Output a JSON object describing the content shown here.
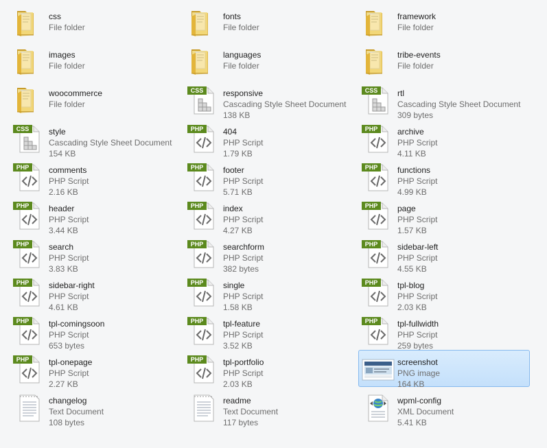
{
  "files": [
    {
      "name": "css",
      "type": "File folder",
      "size": "",
      "icon": "folder-icon"
    },
    {
      "name": "fonts",
      "type": "File folder",
      "size": "",
      "icon": "folder-icon"
    },
    {
      "name": "framework",
      "type": "File folder",
      "size": "",
      "icon": "folder-icon"
    },
    {
      "name": "images",
      "type": "File folder",
      "size": "",
      "icon": "folder-icon"
    },
    {
      "name": "languages",
      "type": "File folder",
      "size": "",
      "icon": "folder-icon"
    },
    {
      "name": "tribe-events",
      "type": "File folder",
      "size": "",
      "icon": "folder-icon"
    },
    {
      "name": "woocommerce",
      "type": "File folder",
      "size": "",
      "icon": "folder-icon"
    },
    {
      "name": "responsive",
      "type": "Cascading Style Sheet Document",
      "size": "138 KB",
      "icon": "css-file-icon"
    },
    {
      "name": "rtl",
      "type": "Cascading Style Sheet Document",
      "size": "309 bytes",
      "icon": "css-file-icon"
    },
    {
      "name": "style",
      "type": "Cascading Style Sheet Document",
      "size": "154 KB",
      "icon": "css-file-icon"
    },
    {
      "name": "404",
      "type": "PHP Script",
      "size": "1.79 KB",
      "icon": "php-file-icon"
    },
    {
      "name": "archive",
      "type": "PHP Script",
      "size": "4.11 KB",
      "icon": "php-file-icon"
    },
    {
      "name": "comments",
      "type": "PHP Script",
      "size": "2.16 KB",
      "icon": "php-file-icon"
    },
    {
      "name": "footer",
      "type": "PHP Script",
      "size": "5.71 KB",
      "icon": "php-file-icon"
    },
    {
      "name": "functions",
      "type": "PHP Script",
      "size": "4.99 KB",
      "icon": "php-file-icon"
    },
    {
      "name": "header",
      "type": "PHP Script",
      "size": "3.44 KB",
      "icon": "php-file-icon"
    },
    {
      "name": "index",
      "type": "PHP Script",
      "size": "4.27 KB",
      "icon": "php-file-icon"
    },
    {
      "name": "page",
      "type": "PHP Script",
      "size": "1.57 KB",
      "icon": "php-file-icon"
    },
    {
      "name": "search",
      "type": "PHP Script",
      "size": "3.83 KB",
      "icon": "php-file-icon"
    },
    {
      "name": "searchform",
      "type": "PHP Script",
      "size": "382 bytes",
      "icon": "php-file-icon"
    },
    {
      "name": "sidebar-left",
      "type": "PHP Script",
      "size": "4.55 KB",
      "icon": "php-file-icon"
    },
    {
      "name": "sidebar-right",
      "type": "PHP Script",
      "size": "4.61 KB",
      "icon": "php-file-icon"
    },
    {
      "name": "single",
      "type": "PHP Script",
      "size": "1.58 KB",
      "icon": "php-file-icon"
    },
    {
      "name": "tpl-blog",
      "type": "PHP Script",
      "size": "2.03 KB",
      "icon": "php-file-icon"
    },
    {
      "name": "tpl-comingsoon",
      "type": "PHP Script",
      "size": "653 bytes",
      "icon": "php-file-icon"
    },
    {
      "name": "tpl-feature",
      "type": "PHP Script",
      "size": "3.52 KB",
      "icon": "php-file-icon"
    },
    {
      "name": "tpl-fullwidth",
      "type": "PHP Script",
      "size": "259 bytes",
      "icon": "php-file-icon"
    },
    {
      "name": "tpl-onepage",
      "type": "PHP Script",
      "size": "2.27 KB",
      "icon": "php-file-icon"
    },
    {
      "name": "tpl-portfolio",
      "type": "PHP Script",
      "size": "2.03 KB",
      "icon": "php-file-icon"
    },
    {
      "name": "screenshot",
      "type": "PNG image",
      "size": "164 KB",
      "icon": "png-image-icon",
      "selected": true
    },
    {
      "name": "changelog",
      "type": "Text Document",
      "size": "108 bytes",
      "icon": "text-file-icon"
    },
    {
      "name": "readme",
      "type": "Text Document",
      "size": "117 bytes",
      "icon": "text-file-icon"
    },
    {
      "name": "wpml-config",
      "type": "XML Document",
      "size": "5.41 KB",
      "icon": "xml-file-icon"
    }
  ],
  "colors": {
    "selection_bg": "#cce4fb",
    "selection_border": "#86b9ee",
    "php_badge": "#5c8a1e",
    "css_badge": "#5c8a1e",
    "folder": "#e7c24a"
  },
  "badges": {
    "php": "PHP",
    "css": "CSS"
  }
}
